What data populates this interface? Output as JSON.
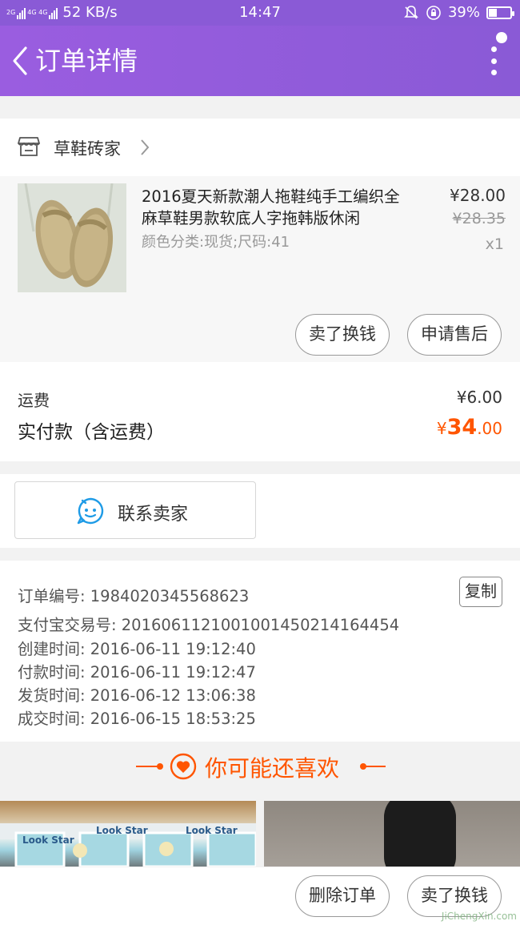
{
  "status_bar": {
    "net_top": "2G",
    "net_mid": "4G 4G",
    "speed": "52 KB/s",
    "time": "14:47",
    "battery_text": "39%",
    "battery_level": 0.39
  },
  "header": {
    "title": "订单详情"
  },
  "shop": {
    "name": "草鞋砖家"
  },
  "product": {
    "title": "2016夏天新款潮人拖鞋纯手工编织全麻草鞋男款软底人字拖韩版休闲",
    "spec": "颜色分类:现货;尺码:41",
    "price": "¥28.00",
    "original_price": "¥28.35",
    "quantity": "x1",
    "buttons": {
      "sell": "卖了换钱",
      "after_sale": "申请售后"
    }
  },
  "fees": {
    "shipping_label": "运费",
    "shipping_value": "¥6.00",
    "paid_label": "实付款（含运费）",
    "paid_currency": "¥",
    "paid_integer": "34",
    "paid_decimal": ".00"
  },
  "contact": {
    "label": "联系卖家"
  },
  "order_info": {
    "order_no": "订单编号: 1984020345568623",
    "copy": "复制",
    "alipay_no": "支付宝交易号: 2016061121001001450214164454",
    "created": "创建时间: 2016-06-11 19:12:40",
    "paid": "付款时间: 2016-06-11 19:12:47",
    "shipped": "发货时间: 2016-06-12 13:06:38",
    "completed": "成交时间: 2016-06-15 18:53:25"
  },
  "recommend": {
    "title": "你可能还喜欢",
    "shop_sign": "Look Star"
  },
  "bottom_bar": {
    "delete": "删除订单",
    "sell": "卖了换钱"
  },
  "watermark": "JiChengXin.com",
  "colors": {
    "accent": "#8a5ad6",
    "price_orange": "#ff5500",
    "chat_blue": "#1e9be6"
  }
}
